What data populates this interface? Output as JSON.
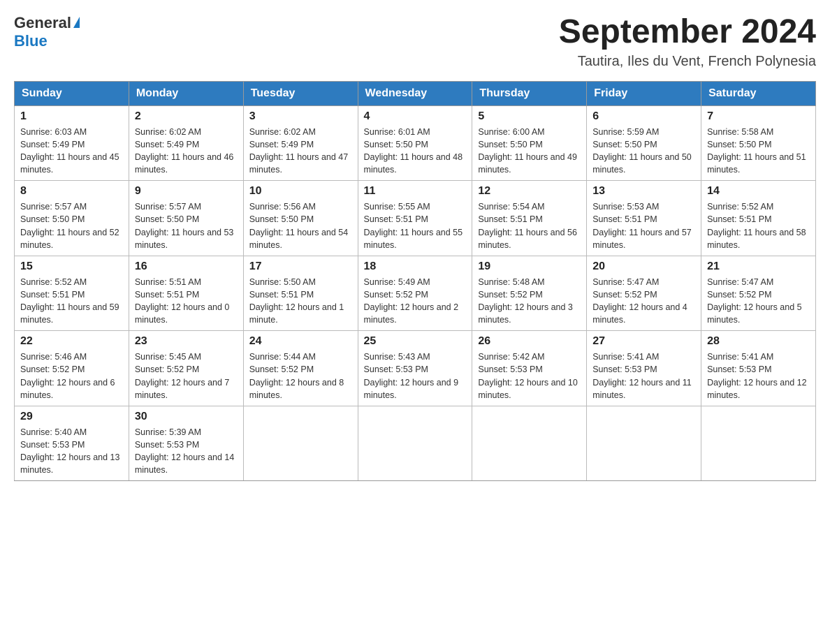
{
  "header": {
    "logo_line1": "General",
    "logo_line2": "Blue",
    "title": "September 2024",
    "subtitle": "Tautira, Iles du Vent, French Polynesia"
  },
  "days_of_week": [
    "Sunday",
    "Monday",
    "Tuesday",
    "Wednesday",
    "Thursday",
    "Friday",
    "Saturday"
  ],
  "weeks": [
    [
      {
        "day": "1",
        "sunrise": "6:03 AM",
        "sunset": "5:49 PM",
        "daylight": "11 hours and 45 minutes."
      },
      {
        "day": "2",
        "sunrise": "6:02 AM",
        "sunset": "5:49 PM",
        "daylight": "11 hours and 46 minutes."
      },
      {
        "day": "3",
        "sunrise": "6:02 AM",
        "sunset": "5:49 PM",
        "daylight": "11 hours and 47 minutes."
      },
      {
        "day": "4",
        "sunrise": "6:01 AM",
        "sunset": "5:50 PM",
        "daylight": "11 hours and 48 minutes."
      },
      {
        "day": "5",
        "sunrise": "6:00 AM",
        "sunset": "5:50 PM",
        "daylight": "11 hours and 49 minutes."
      },
      {
        "day": "6",
        "sunrise": "5:59 AM",
        "sunset": "5:50 PM",
        "daylight": "11 hours and 50 minutes."
      },
      {
        "day": "7",
        "sunrise": "5:58 AM",
        "sunset": "5:50 PM",
        "daylight": "11 hours and 51 minutes."
      }
    ],
    [
      {
        "day": "8",
        "sunrise": "5:57 AM",
        "sunset": "5:50 PM",
        "daylight": "11 hours and 52 minutes."
      },
      {
        "day": "9",
        "sunrise": "5:57 AM",
        "sunset": "5:50 PM",
        "daylight": "11 hours and 53 minutes."
      },
      {
        "day": "10",
        "sunrise": "5:56 AM",
        "sunset": "5:50 PM",
        "daylight": "11 hours and 54 minutes."
      },
      {
        "day": "11",
        "sunrise": "5:55 AM",
        "sunset": "5:51 PM",
        "daylight": "11 hours and 55 minutes."
      },
      {
        "day": "12",
        "sunrise": "5:54 AM",
        "sunset": "5:51 PM",
        "daylight": "11 hours and 56 minutes."
      },
      {
        "day": "13",
        "sunrise": "5:53 AM",
        "sunset": "5:51 PM",
        "daylight": "11 hours and 57 minutes."
      },
      {
        "day": "14",
        "sunrise": "5:52 AM",
        "sunset": "5:51 PM",
        "daylight": "11 hours and 58 minutes."
      }
    ],
    [
      {
        "day": "15",
        "sunrise": "5:52 AM",
        "sunset": "5:51 PM",
        "daylight": "11 hours and 59 minutes."
      },
      {
        "day": "16",
        "sunrise": "5:51 AM",
        "sunset": "5:51 PM",
        "daylight": "12 hours and 0 minutes."
      },
      {
        "day": "17",
        "sunrise": "5:50 AM",
        "sunset": "5:51 PM",
        "daylight": "12 hours and 1 minute."
      },
      {
        "day": "18",
        "sunrise": "5:49 AM",
        "sunset": "5:52 PM",
        "daylight": "12 hours and 2 minutes."
      },
      {
        "day": "19",
        "sunrise": "5:48 AM",
        "sunset": "5:52 PM",
        "daylight": "12 hours and 3 minutes."
      },
      {
        "day": "20",
        "sunrise": "5:47 AM",
        "sunset": "5:52 PM",
        "daylight": "12 hours and 4 minutes."
      },
      {
        "day": "21",
        "sunrise": "5:47 AM",
        "sunset": "5:52 PM",
        "daylight": "12 hours and 5 minutes."
      }
    ],
    [
      {
        "day": "22",
        "sunrise": "5:46 AM",
        "sunset": "5:52 PM",
        "daylight": "12 hours and 6 minutes."
      },
      {
        "day": "23",
        "sunrise": "5:45 AM",
        "sunset": "5:52 PM",
        "daylight": "12 hours and 7 minutes."
      },
      {
        "day": "24",
        "sunrise": "5:44 AM",
        "sunset": "5:52 PM",
        "daylight": "12 hours and 8 minutes."
      },
      {
        "day": "25",
        "sunrise": "5:43 AM",
        "sunset": "5:53 PM",
        "daylight": "12 hours and 9 minutes."
      },
      {
        "day": "26",
        "sunrise": "5:42 AM",
        "sunset": "5:53 PM",
        "daylight": "12 hours and 10 minutes."
      },
      {
        "day": "27",
        "sunrise": "5:41 AM",
        "sunset": "5:53 PM",
        "daylight": "12 hours and 11 minutes."
      },
      {
        "day": "28",
        "sunrise": "5:41 AM",
        "sunset": "5:53 PM",
        "daylight": "12 hours and 12 minutes."
      }
    ],
    [
      {
        "day": "29",
        "sunrise": "5:40 AM",
        "sunset": "5:53 PM",
        "daylight": "12 hours and 13 minutes."
      },
      {
        "day": "30",
        "sunrise": "5:39 AM",
        "sunset": "5:53 PM",
        "daylight": "12 hours and 14 minutes."
      },
      null,
      null,
      null,
      null,
      null
    ]
  ],
  "labels": {
    "sunrise_prefix": "Sunrise: ",
    "sunset_prefix": "Sunset: ",
    "daylight_prefix": "Daylight: "
  }
}
